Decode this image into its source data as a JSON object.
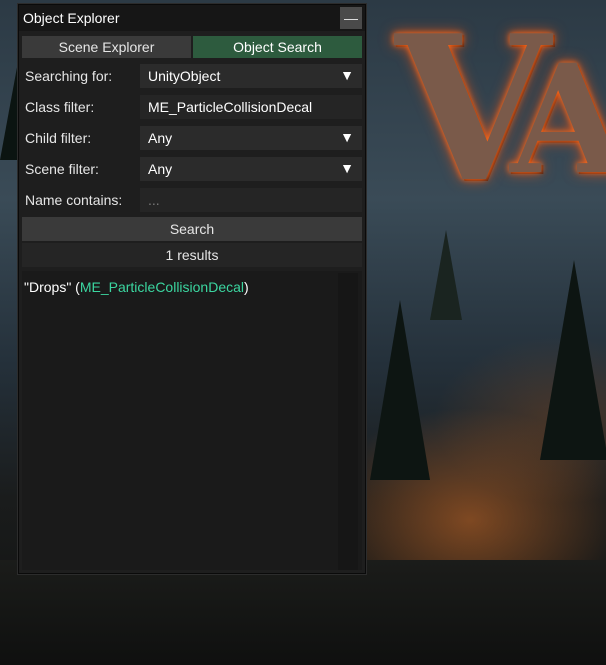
{
  "window": {
    "title": "Object Explorer",
    "minimize_symbol": "—"
  },
  "tabs": [
    {
      "label": "Scene Explorer",
      "active": false
    },
    {
      "label": "Object Search",
      "active": true
    }
  ],
  "form": {
    "searching_for": {
      "label": "Searching for:",
      "value": "UnityObject"
    },
    "class_filter": {
      "label": "Class filter:",
      "value": "ME_ParticleCollisionDecal"
    },
    "child_filter": {
      "label": "Child filter:",
      "value": "Any"
    },
    "scene_filter": {
      "label": "Scene filter:",
      "value": "Any"
    },
    "name_contains": {
      "label": "Name contains:",
      "value": "",
      "placeholder": "..."
    },
    "dropdown_arrow": "▼"
  },
  "search_button": "Search",
  "results": {
    "count_text": "1 results",
    "items": [
      {
        "open": "\"Drops\" (",
        "type": "ME_ParticleCollisionDecal",
        "close": ")"
      }
    ]
  },
  "background": {
    "logo_letters": [
      "V",
      "A"
    ]
  },
  "colors": {
    "active_tab": "#2d5b3e",
    "type_name": "#3bd6a0",
    "panel_bg": "#1e1e1e"
  }
}
